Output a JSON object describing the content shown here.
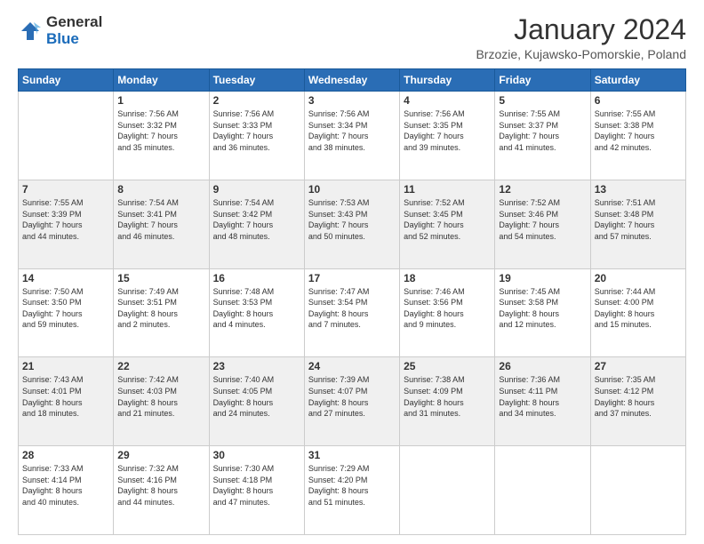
{
  "logo": {
    "general": "General",
    "blue": "Blue"
  },
  "title": "January 2024",
  "location": "Brzozie, Kujawsko-Pomorskie, Poland",
  "days_header": [
    "Sunday",
    "Monday",
    "Tuesday",
    "Wednesday",
    "Thursday",
    "Friday",
    "Saturday"
  ],
  "weeks": [
    [
      {
        "day": "",
        "info": ""
      },
      {
        "day": "1",
        "info": "Sunrise: 7:56 AM\nSunset: 3:32 PM\nDaylight: 7 hours\nand 35 minutes."
      },
      {
        "day": "2",
        "info": "Sunrise: 7:56 AM\nSunset: 3:33 PM\nDaylight: 7 hours\nand 36 minutes."
      },
      {
        "day": "3",
        "info": "Sunrise: 7:56 AM\nSunset: 3:34 PM\nDaylight: 7 hours\nand 38 minutes."
      },
      {
        "day": "4",
        "info": "Sunrise: 7:56 AM\nSunset: 3:35 PM\nDaylight: 7 hours\nand 39 minutes."
      },
      {
        "day": "5",
        "info": "Sunrise: 7:55 AM\nSunset: 3:37 PM\nDaylight: 7 hours\nand 41 minutes."
      },
      {
        "day": "6",
        "info": "Sunrise: 7:55 AM\nSunset: 3:38 PM\nDaylight: 7 hours\nand 42 minutes."
      }
    ],
    [
      {
        "day": "7",
        "info": "Sunrise: 7:55 AM\nSunset: 3:39 PM\nDaylight: 7 hours\nand 44 minutes."
      },
      {
        "day": "8",
        "info": "Sunrise: 7:54 AM\nSunset: 3:41 PM\nDaylight: 7 hours\nand 46 minutes."
      },
      {
        "day": "9",
        "info": "Sunrise: 7:54 AM\nSunset: 3:42 PM\nDaylight: 7 hours\nand 48 minutes."
      },
      {
        "day": "10",
        "info": "Sunrise: 7:53 AM\nSunset: 3:43 PM\nDaylight: 7 hours\nand 50 minutes."
      },
      {
        "day": "11",
        "info": "Sunrise: 7:52 AM\nSunset: 3:45 PM\nDaylight: 7 hours\nand 52 minutes."
      },
      {
        "day": "12",
        "info": "Sunrise: 7:52 AM\nSunset: 3:46 PM\nDaylight: 7 hours\nand 54 minutes."
      },
      {
        "day": "13",
        "info": "Sunrise: 7:51 AM\nSunset: 3:48 PM\nDaylight: 7 hours\nand 57 minutes."
      }
    ],
    [
      {
        "day": "14",
        "info": "Sunrise: 7:50 AM\nSunset: 3:50 PM\nDaylight: 7 hours\nand 59 minutes."
      },
      {
        "day": "15",
        "info": "Sunrise: 7:49 AM\nSunset: 3:51 PM\nDaylight: 8 hours\nand 2 minutes."
      },
      {
        "day": "16",
        "info": "Sunrise: 7:48 AM\nSunset: 3:53 PM\nDaylight: 8 hours\nand 4 minutes."
      },
      {
        "day": "17",
        "info": "Sunrise: 7:47 AM\nSunset: 3:54 PM\nDaylight: 8 hours\nand 7 minutes."
      },
      {
        "day": "18",
        "info": "Sunrise: 7:46 AM\nSunset: 3:56 PM\nDaylight: 8 hours\nand 9 minutes."
      },
      {
        "day": "19",
        "info": "Sunrise: 7:45 AM\nSunset: 3:58 PM\nDaylight: 8 hours\nand 12 minutes."
      },
      {
        "day": "20",
        "info": "Sunrise: 7:44 AM\nSunset: 4:00 PM\nDaylight: 8 hours\nand 15 minutes."
      }
    ],
    [
      {
        "day": "21",
        "info": "Sunrise: 7:43 AM\nSunset: 4:01 PM\nDaylight: 8 hours\nand 18 minutes."
      },
      {
        "day": "22",
        "info": "Sunrise: 7:42 AM\nSunset: 4:03 PM\nDaylight: 8 hours\nand 21 minutes."
      },
      {
        "day": "23",
        "info": "Sunrise: 7:40 AM\nSunset: 4:05 PM\nDaylight: 8 hours\nand 24 minutes."
      },
      {
        "day": "24",
        "info": "Sunrise: 7:39 AM\nSunset: 4:07 PM\nDaylight: 8 hours\nand 27 minutes."
      },
      {
        "day": "25",
        "info": "Sunrise: 7:38 AM\nSunset: 4:09 PM\nDaylight: 8 hours\nand 31 minutes."
      },
      {
        "day": "26",
        "info": "Sunrise: 7:36 AM\nSunset: 4:11 PM\nDaylight: 8 hours\nand 34 minutes."
      },
      {
        "day": "27",
        "info": "Sunrise: 7:35 AM\nSunset: 4:12 PM\nDaylight: 8 hours\nand 37 minutes."
      }
    ],
    [
      {
        "day": "28",
        "info": "Sunrise: 7:33 AM\nSunset: 4:14 PM\nDaylight: 8 hours\nand 40 minutes."
      },
      {
        "day": "29",
        "info": "Sunrise: 7:32 AM\nSunset: 4:16 PM\nDaylight: 8 hours\nand 44 minutes."
      },
      {
        "day": "30",
        "info": "Sunrise: 7:30 AM\nSunset: 4:18 PM\nDaylight: 8 hours\nand 47 minutes."
      },
      {
        "day": "31",
        "info": "Sunrise: 7:29 AM\nSunset: 4:20 PM\nDaylight: 8 hours\nand 51 minutes."
      },
      {
        "day": "",
        "info": ""
      },
      {
        "day": "",
        "info": ""
      },
      {
        "day": "",
        "info": ""
      }
    ]
  ]
}
